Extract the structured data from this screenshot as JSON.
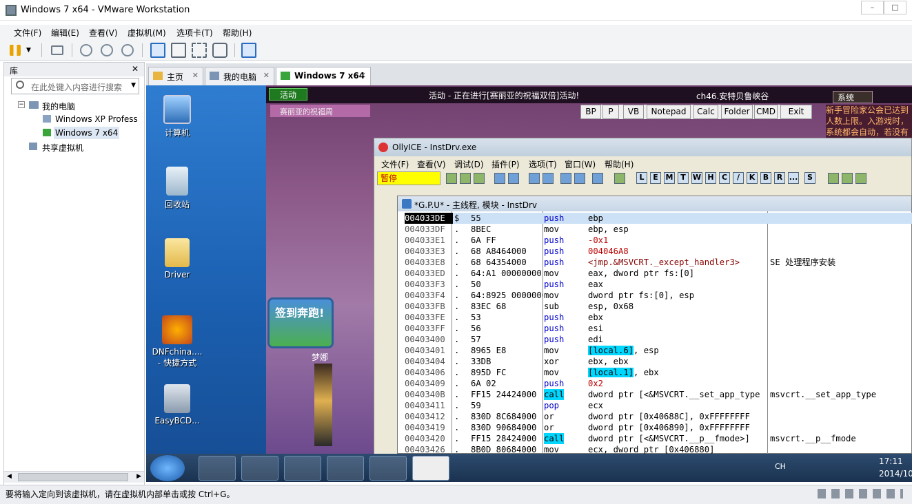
{
  "window": {
    "title": "Windows 7 x64 - VMware Workstation"
  },
  "menu": [
    "文件(F)",
    "编辑(E)",
    "查看(V)",
    "虚拟机(M)",
    "选项卡(T)",
    "帮助(H)"
  ],
  "library": {
    "title": "库",
    "search_placeholder": "在此处键入内容进行搜索",
    "tree": [
      "我的电脑",
      "Windows XP Profess",
      "Windows 7 x64",
      "共享虚拟机"
    ]
  },
  "tabs": [
    "主页",
    "我的电脑",
    "Windows 7 x64"
  ],
  "desktop": [
    "计算机",
    "回收站",
    "Driver",
    "DNFchina....\n- 快捷方式",
    "EasyBCD..."
  ],
  "game": {
    "activity_tab": "活动",
    "banner": "活动 - 正在进行[赛丽亚的祝福双倍]活动!",
    "channel": "ch46.安特贝鲁峡谷",
    "system": "系统",
    "notice": "新手冒险家公会已达到人数上限。入游戏时，系统都会自动，若没有达到上限，将会",
    "checkin": "签到奔跑!",
    "npc": "梦娜",
    "sub": "赛丽亚的祝福周",
    "toolbar": [
      "BP",
      "P",
      "VB",
      "Notepad",
      "Calc",
      "Folder",
      "CMD",
      "Exit"
    ]
  },
  "olly": {
    "title": "OllyICE - InstDrv.exe",
    "menu": [
      "文件(F)",
      "查看(V)",
      "调试(D)",
      "插件(P)",
      "选项(T)",
      "窗口(W)",
      "帮助(H)"
    ],
    "status": "暂停",
    "letters": [
      "L",
      "E",
      "M",
      "T",
      "W",
      "H",
      "C",
      "/",
      "K",
      "B",
      "R",
      "...",
      "S"
    ]
  },
  "cpu": {
    "title": "*G.P.U* - 主线程, 模块 - InstDrv",
    "rows": [
      [
        "004033DE",
        "$",
        "55",
        "push",
        "ebp",
        ""
      ],
      [
        "004033DF",
        ".",
        "8BEC",
        "mov",
        "ebp, esp",
        ""
      ],
      [
        "004033E1",
        ".",
        "6A FF",
        "push",
        "-0x1",
        ""
      ],
      [
        "004033E3",
        ".",
        "68 A8464000",
        "push",
        "004046A8",
        ""
      ],
      [
        "004033E8",
        ".",
        "68 64354000",
        "push",
        "<jmp.&MSVCRT._except_handler3>",
        "SE 处理程序安装"
      ],
      [
        "004033ED",
        ".",
        "64:A1 00000000",
        "mov",
        "eax, dword ptr fs:[0]",
        ""
      ],
      [
        "004033F3",
        ".",
        "50",
        "push",
        "eax",
        ""
      ],
      [
        "004033F4",
        ".",
        "64:8925 00000000",
        "mov",
        "dword ptr fs:[0], esp",
        ""
      ],
      [
        "004033FB",
        ".",
        "83EC 68",
        "sub",
        "esp, 0x68",
        ""
      ],
      [
        "004033FE",
        ".",
        "53",
        "push",
        "ebx",
        ""
      ],
      [
        "004033FF",
        ".",
        "56",
        "push",
        "esi",
        ""
      ],
      [
        "00403400",
        ".",
        "57",
        "push",
        "edi",
        ""
      ],
      [
        "00403401",
        ".",
        "8965 E8",
        "mov",
        "[local.6], esp",
        ""
      ],
      [
        "00403404",
        ".",
        "33DB",
        "xor",
        "ebx, ebx",
        ""
      ],
      [
        "00403406",
        ".",
        "895D FC",
        "mov",
        "[local.1], ebx",
        ""
      ],
      [
        "00403409",
        ".",
        "6A 02",
        "push",
        "0x2",
        ""
      ],
      [
        "0040340B",
        ".",
        "FF15 24424000",
        "call",
        "dword ptr [<&MSVCRT.__set_app_type",
        "msvcrt.__set_app_type"
      ],
      [
        "00403411",
        ".",
        "59",
        "pop",
        "ecx",
        ""
      ],
      [
        "00403412",
        ".",
        "830D 8C684000",
        "or",
        "dword ptr [0x40688C], 0xFFFFFFFF",
        ""
      ],
      [
        "00403419",
        ".",
        "830D 90684000",
        "or",
        "dword ptr [0x406890], 0xFFFFFFFF",
        ""
      ],
      [
        "00403420",
        ".",
        "FF15 28424000",
        "call",
        "dword ptr [<&MSVCRT.__p__fmode>]",
        "msvcrt.__p__fmode"
      ],
      [
        "00403426",
        ".",
        "8B0D 80684000",
        "mov",
        "ecx, dword ptr [0x406880]",
        ""
      ]
    ]
  },
  "taskbar": {
    "time": "17:11",
    "date": "2014/10",
    "lang": "CH"
  },
  "statusbar": {
    "text": "要将输入定向到该虚拟机，请在虚拟机内部单击或按 Ctrl+G。"
  }
}
